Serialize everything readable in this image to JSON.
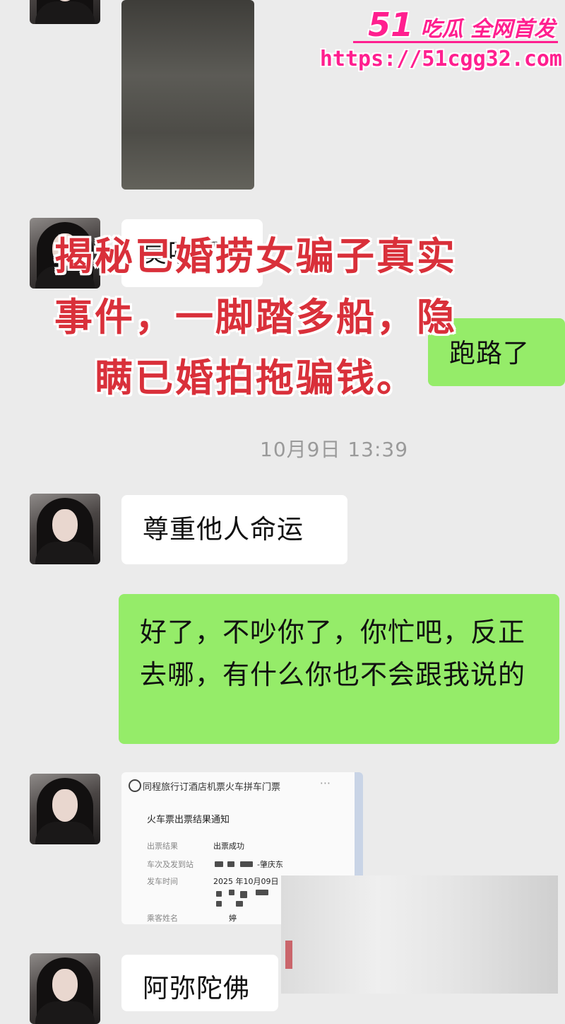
{
  "watermark": {
    "brand_num": "51",
    "brand_text": "吃瓜 全网首发",
    "url": "https://51cgg32.com"
  },
  "messages": {
    "partial_left_1": "莫吵了",
    "right_1": "跑路了",
    "timestamp": "10月9日 13:39",
    "left_2": "尊重他人命运",
    "right_2": "好了，不吵你了，你忙吧，反正去哪，有什么你也不会跟我说的",
    "left_last": "阿弥陀佛"
  },
  "overlay_caption": "揭秘已婚捞女骗子真实事件，一脚踏多船，隐瞒已婚拍拖骗钱。",
  "ticket": {
    "header": "同程旅行订酒店机票火车拼车门票",
    "dots": "···",
    "title": "火车票出票结果通知",
    "rows": [
      {
        "label": "出票结果",
        "value": "出票成功"
      },
      {
        "label": "车次及发到站",
        "value": "-肇庆东"
      },
      {
        "label": "发车时间",
        "value": "2025 年10月09日"
      },
      {
        "label": "",
        "value": ""
      },
      {
        "label": "乘客姓名",
        "value": "婷"
      }
    ]
  },
  "colors": {
    "green_bubble": "#95ec69",
    "white_bubble": "#ffffff",
    "overlay_text": "#d9303a",
    "watermark": "#ff1f8f",
    "background": "#ebebeb"
  }
}
